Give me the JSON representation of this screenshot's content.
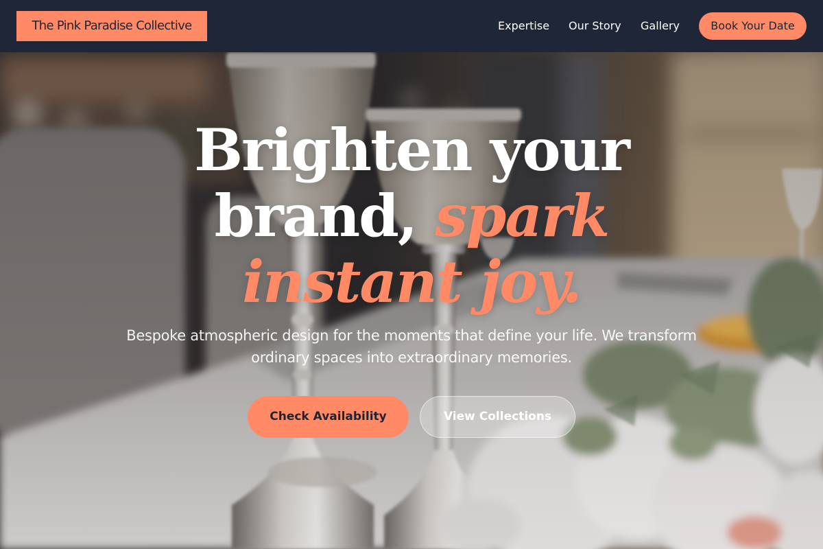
{
  "header": {
    "brand_name": "The Pink Paradise Collective",
    "nav": [
      {
        "label": "Expertise"
      },
      {
        "label": "Our Story"
      },
      {
        "label": "Gallery"
      }
    ],
    "cta_label": "Book Your Date"
  },
  "hero": {
    "headline_line1": "Brighten your",
    "headline_line2_plain": "brand, ",
    "headline_line2_accent": "spark",
    "headline_line3_accent": "instant joy.",
    "subtitle": "Bespoke atmospheric design for the moments that define your life. We transform ordinary spaces into extraordinary memories.",
    "primary_cta": "Check Availability",
    "secondary_cta": "View Collections"
  },
  "colors": {
    "header_background": "#1e2638",
    "accent": "#ff8a65",
    "dark_text": "#1f2433",
    "light_text": "#ffffff"
  }
}
